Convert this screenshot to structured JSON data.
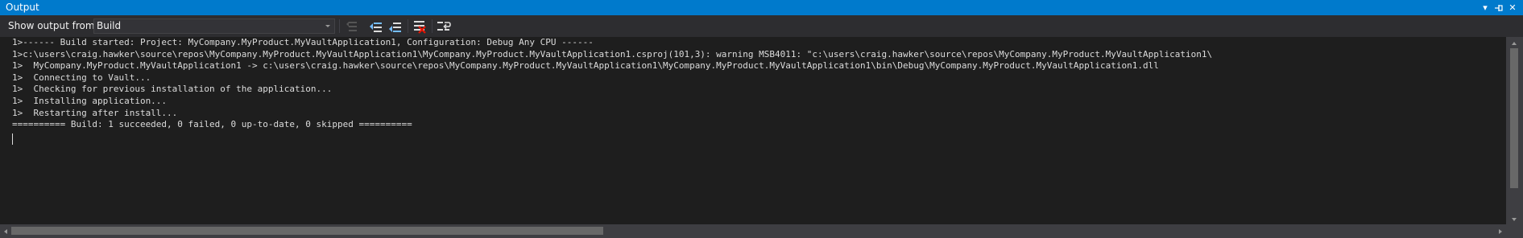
{
  "window": {
    "title": "Output",
    "controls": {
      "dropdown_glyph": "▾",
      "pin_glyph": "⊣",
      "close_glyph": "✕"
    }
  },
  "toolbar": {
    "show_output_label": "Show output from:",
    "source_value": "Build",
    "buttons": [
      {
        "name": "go-to-previous-message-icon",
        "enabled": false
      },
      {
        "name": "find-message-in-code-icon",
        "enabled": true
      },
      {
        "name": "go-to-next-message-icon",
        "enabled": true
      },
      {
        "name": "clear-all-icon",
        "enabled": true
      },
      {
        "name": "toggle-word-wrap-icon",
        "enabled": true
      }
    ]
  },
  "output": {
    "lines": [
      "1>------ Build started: Project: MyCompany.MyProduct.MyVaultApplication1, Configuration: Debug Any CPU ------",
      "1>c:\\users\\craig.hawker\\source\\repos\\MyCompany.MyProduct.MyVaultApplication1\\MyCompany.MyProduct.MyVaultApplication1.csproj(101,3): warning MSB4011: \"c:\\users\\craig.hawker\\source\\repos\\MyCompany.MyProduct.MyVaultApplication1\\",
      "1>  MyCompany.MyProduct.MyVaultApplication1 -> c:\\users\\craig.hawker\\source\\repos\\MyCompany.MyProduct.MyVaultApplication1\\MyCompany.MyProduct.MyVaultApplication1\\bin\\Debug\\MyCompany.MyProduct.MyVaultApplication1.dll",
      "1>  Connecting to Vault...",
      "1>  Checking for previous installation of the application...",
      "1>  Installing application...",
      "1>  Restarting after install...",
      "========== Build: 1 succeeded, 0 failed, 0 up-to-date, 0 skipped =========="
    ]
  },
  "colors": {
    "title_bar": "#007acc",
    "toolbar": "#2d2d30",
    "editor_bg": "#1e1e1e",
    "text": "#dcdcdc",
    "scrollbar_thumb": "#686868"
  }
}
